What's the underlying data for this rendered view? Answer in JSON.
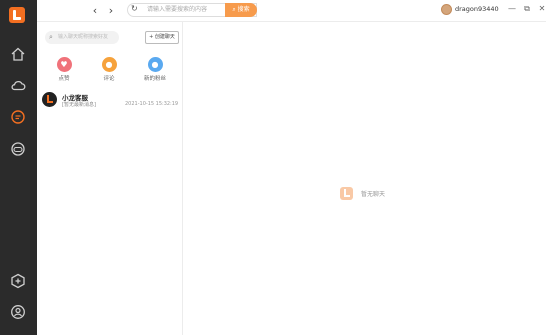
{
  "topbar": {
    "back_icon": "chevron-left-icon",
    "forward_icon": "chevron-right-icon",
    "refresh_icon": "refresh-icon",
    "search_placeholder": "请输入需要搜索的内容",
    "search_button": "搜索",
    "username": "dragon93440",
    "win_min": "—",
    "win_max": "⧉",
    "win_close": "✕"
  },
  "sidebar": {
    "items": [
      {
        "icon": "home-icon"
      },
      {
        "icon": "cloud-icon"
      },
      {
        "icon": "chat-icon",
        "active": true
      },
      {
        "icon": "game-icon"
      },
      {
        "icon": "plus-cube-icon"
      },
      {
        "icon": "user-icon"
      }
    ]
  },
  "list": {
    "search_placeholder": "输入聊天昵称搜索好友",
    "create_button": "+ 创建聊天",
    "quick": [
      {
        "label": "点赞",
        "icon": "heart-icon",
        "color": "#f0727a"
      },
      {
        "label": "评论",
        "icon": "comment-icon",
        "color": "#f6a23c"
      },
      {
        "label": "新的粉丝",
        "icon": "fans-icon",
        "color": "#5aa9f0"
      }
    ],
    "chats": [
      {
        "name": "小龙客服",
        "preview": "[暂无最新消息]",
        "time": "2021-10-15 15:32:19"
      }
    ]
  },
  "main": {
    "empty_text": "暂无聊天"
  },
  "colors": {
    "accent": "#f36f21",
    "sidebar_bg": "#2b2b2b",
    "search_button": "#f79b4c"
  }
}
